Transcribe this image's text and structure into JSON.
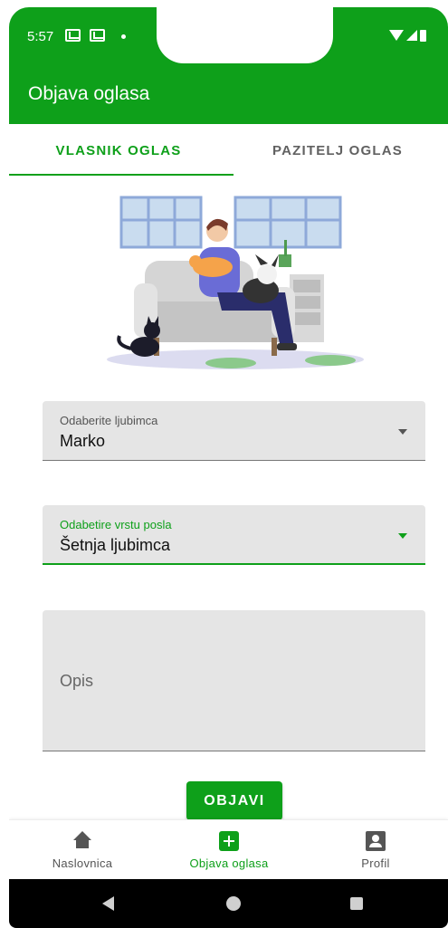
{
  "status_bar": {
    "time": "5:57"
  },
  "appbar": {
    "title": "Objava oglasa"
  },
  "tabs": [
    {
      "label": "VLASNIK OGLAS",
      "selected": true
    },
    {
      "label": "PAZITELJ OGLAS",
      "selected": false
    }
  ],
  "form": {
    "pet": {
      "label": "Odaberite ljubimca",
      "value": "Marko"
    },
    "job_type": {
      "label": "Odabetire vrstu posla",
      "value": "Šetnja ljubimca"
    },
    "description": {
      "placeholder": "Opis"
    },
    "submit_label": "OBJAVI"
  },
  "bottom_nav": [
    {
      "label": "Naslovnica",
      "icon": "home-icon"
    },
    {
      "label": "Objava oglasa",
      "icon": "add-box-icon",
      "selected": true
    },
    {
      "label": "Profil",
      "icon": "account-box-icon"
    }
  ],
  "colors": {
    "primary": "#0ea01a",
    "field_bg": "#e5e5e5"
  }
}
